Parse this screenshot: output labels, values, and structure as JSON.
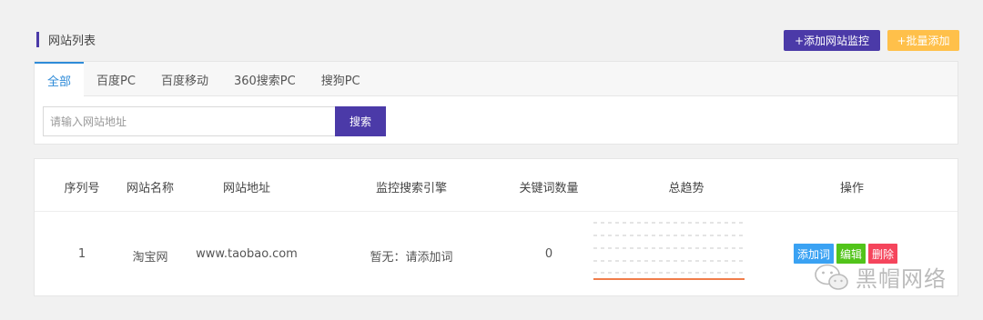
{
  "header": {
    "title": "网站列表",
    "add_button": "+添加网站监控",
    "batch_button": "+批量添加"
  },
  "tabs": [
    {
      "label": "全部",
      "active": true
    },
    {
      "label": "百度PC"
    },
    {
      "label": "百度移动"
    },
    {
      "label": "360搜索PC"
    },
    {
      "label": "搜狗PC"
    }
  ],
  "search": {
    "placeholder": "请输入网站地址",
    "button": "搜索"
  },
  "table": {
    "columns": [
      "序列号",
      "网站名称",
      "网站地址",
      "监控搜索引擎",
      "关键词数量",
      "总趋势",
      "操作"
    ],
    "rows": [
      {
        "index": "1",
        "name": "淘宝网",
        "url": "www.taobao.com",
        "engine": "暂无：请添加词",
        "keywords": "0",
        "actions": [
          "添加词",
          "编辑",
          "删除"
        ]
      }
    ]
  },
  "watermark": {
    "text": "黑帽网络",
    "icon": "wechat-icon"
  },
  "colors": {
    "primary": "#4b3aa8",
    "warning": "#ffc04a",
    "tab_active": "#2e8bd8",
    "op_add": "#3aa2f3",
    "op_edit": "#52c41a",
    "op_delete": "#f5455c",
    "trend_line": "#f07c4a"
  }
}
